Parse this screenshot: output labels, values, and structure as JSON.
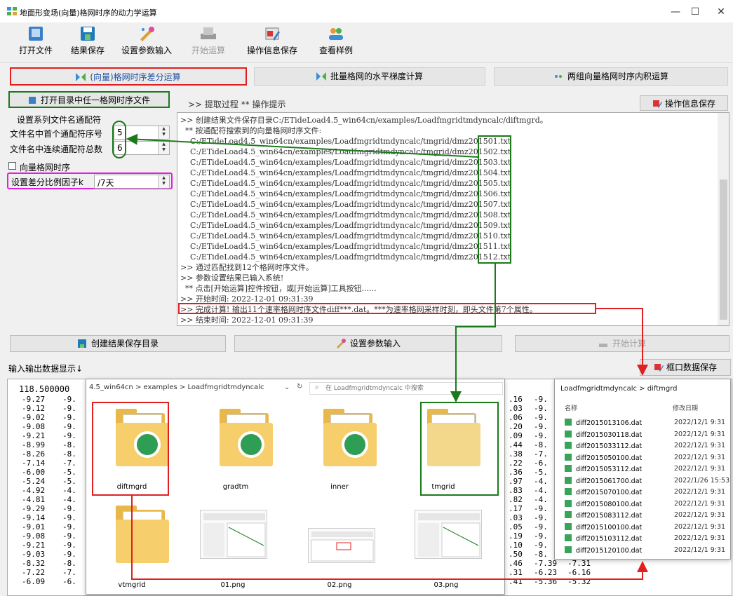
{
  "window": {
    "title": "地面形变场(向量)格网时序的动力学运算",
    "controls": [
      "—",
      "☐",
      "✕"
    ]
  },
  "toolbar": {
    "open_file": "打开文件",
    "save_result": "结果保存",
    "set_params": "设置参数输入",
    "start_calc": "开始运算",
    "save_op_info": "操作信息保存",
    "view_sample": "查看样例"
  },
  "tabs": {
    "tab1": "(向量)格网时序差分运算",
    "tab2": "批量格网的水平梯度计算",
    "tab3": "两组向量格网时序内积运算"
  },
  "left_panel": {
    "open_dir_button": "打开目录中任一格网时序文件",
    "wildcard_header": "设置系列文件名通配符",
    "first_wildcard_label": "文件名中首个通配符序号",
    "first_wildcard_value": "5",
    "total_wildcard_label": "文件名中连续通配符总数",
    "total_wildcard_value": "6",
    "vector_checkbox_label": "向量格网时序",
    "diff_factor_label": "设置差分比例因子k",
    "diff_factor_value": "/7天"
  },
  "log_header": {
    "label": ">> 提取过程  ** 操作提示",
    "save_button": "操作信息保存"
  },
  "log_lines": [
    ">> 创建结果文件保存目录C:/ETideLoad4.5_win64cn/examples/Loadfmgridtmdyncalc/diftmgrd。",
    "  ** 按通配符搜索到的向量格网时序文件:",
    "    C:/ETideLoad4.5_win64cn/examples/Loadfmgridtmdyncalc/tmgrid/dmz201501.txt",
    "    C:/ETideLoad4.5_win64cn/examples/Loadfmgridtmdyncalc/tmgrid/dmz201502.txt",
    "    C:/ETideLoad4.5_win64cn/examples/Loadfmgridtmdyncalc/tmgrid/dmz201503.txt",
    "    C:/ETideLoad4.5_win64cn/examples/Loadfmgridtmdyncalc/tmgrid/dmz201504.txt",
    "    C:/ETideLoad4.5_win64cn/examples/Loadfmgridtmdyncalc/tmgrid/dmz201505.txt",
    "    C:/ETideLoad4.5_win64cn/examples/Loadfmgridtmdyncalc/tmgrid/dmz201506.txt",
    "    C:/ETideLoad4.5_win64cn/examples/Loadfmgridtmdyncalc/tmgrid/dmz201507.txt",
    "    C:/ETideLoad4.5_win64cn/examples/Loadfmgridtmdyncalc/tmgrid/dmz201508.txt",
    "    C:/ETideLoad4.5_win64cn/examples/Loadfmgridtmdyncalc/tmgrid/dmz201509.txt",
    "    C:/ETideLoad4.5_win64cn/examples/Loadfmgridtmdyncalc/tmgrid/dmz201510.txt",
    "    C:/ETideLoad4.5_win64cn/examples/Loadfmgridtmdyncalc/tmgrid/dmz201511.txt",
    "    C:/ETideLoad4.5_win64cn/examples/Loadfmgridtmdyncalc/tmgrid/dmz201512.txt",
    ">> 通过匹配找到12个格网时序文件。",
    ">> 参数设置结果已输入系统!",
    "  ** 点击[开始运算]控件按钮，或[开始运算]工具按钮......",
    ">> 开始时间: 2022-12-01 09:31:39",
    ">> 完成计算! 输出11个速率格网时序文件diff***.dat。***为速率格网采样时刻，即头文件第7个属性。",
    ">> 结束时间: 2022-12-01 09:31:39"
  ],
  "action_buttons": {
    "create_dir": "创建结果保存目录",
    "set_params": "设置参数输入",
    "start_calc": "开始计算"
  },
  "data_section": {
    "label": "输入输出数据显示↓",
    "save_button": "框口数据保存",
    "first_row": "118.500000",
    "left_col": [
      "-9.27",
      "-9.12",
      "-9.02",
      "-9.08",
      "-9.21",
      "-8.99",
      "-8.26",
      "-7.14",
      "-6.00",
      "-5.24",
      "-4.92",
      "-4.81",
      "-9.29",
      "-9.14",
      "-9.01",
      "-9.08",
      "-9.21",
      "-9.03",
      "-8.32",
      "-7.22",
      "-6.09"
    ],
    "left_col2": [
      "-9.",
      "-9.",
      "-9.",
      "-9.",
      "-9.",
      "-8.",
      "-8.",
      "-7.",
      "-5.",
      "-5.",
      "-4.",
      "-4.",
      "-9.",
      "-9.",
      "-9.",
      "-9.",
      "-9.",
      "-9.",
      "-8.",
      "-7.",
      "-6."
    ],
    "mid_col": [
      ".16",
      ".03",
      ".06",
      ".20",
      ".09",
      ".44",
      ".38",
      ".22",
      ".36",
      ".97",
      ".83",
      ".82",
      ".17",
      ".03",
      ".05",
      ".19",
      ".10",
      ".50",
      ".46",
      ".31",
      ".41"
    ],
    "mid_col2": [
      "-9.",
      "-9.",
      "-9.",
      "-9.",
      "-9.",
      "-8.",
      "-7.",
      "-6.",
      "-5.",
      "-4.",
      "-4.",
      "-4.",
      "-9.",
      "-9.",
      "-9.",
      "-9.",
      "-9.",
      "-8.",
      "-7.39",
      "-6.23",
      "-5.36"
    ],
    "last_col": [
      "",
      "",
      "",
      "",
      "",
      "",
      "",
      "",
      "",
      "",
      "",
      "",
      "",
      "",
      "",
      "",
      "",
      "",
      "-7.31",
      "-6.16",
      "-5.32"
    ]
  },
  "explorer": {
    "breadcrumb": "4.5_win64cn  >  examples  >  Loadfmgridtmdyncalc",
    "search_placeholder": "在 Loadfmgridtmdyncalc 中搜索",
    "folders": [
      "diftmgrd",
      "gradtm",
      "inner",
      "tmgrid",
      "vtmgrid"
    ],
    "images": [
      "01.png",
      "02.png",
      "03.png"
    ]
  },
  "filelist": {
    "breadcrumb": "Loadfmgridtmdyncalc  >  diftmgrd",
    "col_name": "名称",
    "col_date": "修改日期",
    "files": [
      {
        "name": "diff2015013106.dat",
        "date": "2022/12/1 9:31"
      },
      {
        "name": "diff2015030118.dat",
        "date": "2022/12/1 9:31"
      },
      {
        "name": "diff2015033112.dat",
        "date": "2022/12/1 9:31"
      },
      {
        "name": "diff2015050100.dat",
        "date": "2022/12/1 9:31"
      },
      {
        "name": "diff2015053112.dat",
        "date": "2022/12/1 9:31"
      },
      {
        "name": "diff2015061700.dat",
        "date": "2022/1/26 15:53"
      },
      {
        "name": "diff2015070100.dat",
        "date": "2022/12/1 9:31"
      },
      {
        "name": "diff2015080100.dat",
        "date": "2022/12/1 9:31"
      },
      {
        "name": "diff2015083112.dat",
        "date": "2022/12/1 9:31"
      },
      {
        "name": "diff2015100100.dat",
        "date": "2022/12/1 9:31"
      },
      {
        "name": "diff2015103112.dat",
        "date": "2022/12/1 9:31"
      },
      {
        "name": "diff2015120100.dat",
        "date": "2022/12/1 9:31"
      }
    ]
  },
  "colors": {
    "annot_red": "#e02020",
    "annot_green": "#1a7a1a",
    "annot_magenta": "#e020e0"
  }
}
